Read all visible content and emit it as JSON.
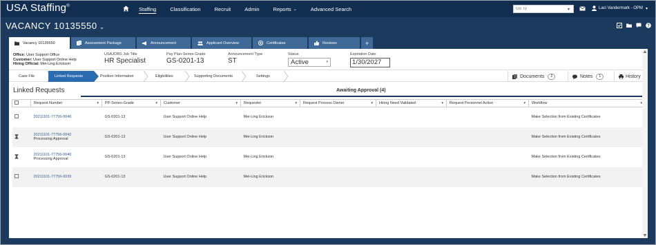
{
  "app": {
    "brand": "USA Staffing",
    "nav": [
      {
        "label": "Staffing",
        "active": true
      },
      {
        "label": "Classification"
      },
      {
        "label": "Recruit"
      },
      {
        "label": "Admin"
      },
      {
        "label": "Reports",
        "has_menu": true
      },
      {
        "label": "Advanced Search"
      }
    ],
    "goto_placeholder": "Go To",
    "user": "Laci Vandermark - OPM"
  },
  "vacancy": {
    "title": "VACANCY 10135550"
  },
  "tabs": [
    {
      "label": "Vacancy 10135550",
      "icon": "folder-icon",
      "active": true
    },
    {
      "label": "Assessment Package",
      "icon": "documents-icon"
    },
    {
      "label": "Announcement",
      "icon": "megaphone-icon"
    },
    {
      "label": "Applicant Overview",
      "icon": "users-icon"
    },
    {
      "label": "Certificates",
      "icon": "certificate-icon"
    },
    {
      "label": "Reviews",
      "icon": "thumbs-up-icon"
    }
  ],
  "info": {
    "office_label": "Office:",
    "office": "User Support Office",
    "customer_label": "Customer:",
    "customer": "User Support Online Help",
    "hiring_label": "Hiring Official:",
    "hiring": "Mei-Ling Erickson",
    "job_title_label": "USAJOBS Job Title",
    "job_title": "HR Specialist",
    "pps_label": "Pay Plan-Series-Grade",
    "pps": "GS-0201-13",
    "ann_type_label": "Announcement Type",
    "ann_type": "ST",
    "status_label": "Status",
    "status": "Active",
    "exp_label": "Expiration Date",
    "exp": "1/30/2027"
  },
  "crumbs": [
    "Case File",
    "Linked Requests",
    "Position Information",
    "Eligibilities",
    "Supporting Documents",
    "Settings"
  ],
  "side": {
    "documents": "Documents",
    "documents_count": "2",
    "notes": "Notes",
    "notes_count": "1",
    "history": "History"
  },
  "linked": {
    "title": "Linked Requests",
    "tab": "Awaiting Approval (4)"
  },
  "table": {
    "headers": [
      "Request Number",
      "PP-Series-Grade",
      "Customer",
      "Requester",
      "Request Process Owner",
      "Hiring Need Validated",
      "Request Personnel Action",
      "Workflow"
    ],
    "rows": [
      {
        "number": "20211101-77756-0046",
        "sub": "",
        "pps": "GS-0201-13",
        "customer": "User Support Online Help",
        "requester": "Mei-Ling Erickson",
        "owner": "",
        "validated": "",
        "action": "",
        "workflow": "Make Selection from Existing Certificates",
        "marker": "checkbox"
      },
      {
        "number": "20211101-77756-0042",
        "sub": "Processing Approval",
        "pps": "GS-0201-13",
        "customer": "User Support Online Help",
        "requester": "Mei-Ling Erickson",
        "owner": "",
        "validated": "",
        "action": "",
        "workflow": "Make Selection from Existing Certificates",
        "marker": "hourglass"
      },
      {
        "number": "20211101-77756-0040",
        "sub": "Processing Approval",
        "pps": "GS-0201-13",
        "customer": "User Support Online Help",
        "requester": "Mei-Ling Erickson",
        "owner": "",
        "validated": "",
        "action": "",
        "workflow": "Make Selection from Existing Certificates",
        "marker": "hourglass"
      },
      {
        "number": "20211101-77756-0039",
        "sub": "",
        "pps": "GS-0201-13",
        "customer": "User Support Online Help",
        "requester": "Mei-Ling Erickson",
        "owner": "",
        "validated": "",
        "action": "",
        "workflow": "Make Selection from Existing Certificates",
        "marker": "checkbox"
      }
    ]
  },
  "colors": {
    "nav_bg": "#112e51",
    "header_bg": "#1b3a5e",
    "tab_bg": "#3f6a97",
    "accent": "#2b6cb0",
    "link": "#2b5d93"
  }
}
